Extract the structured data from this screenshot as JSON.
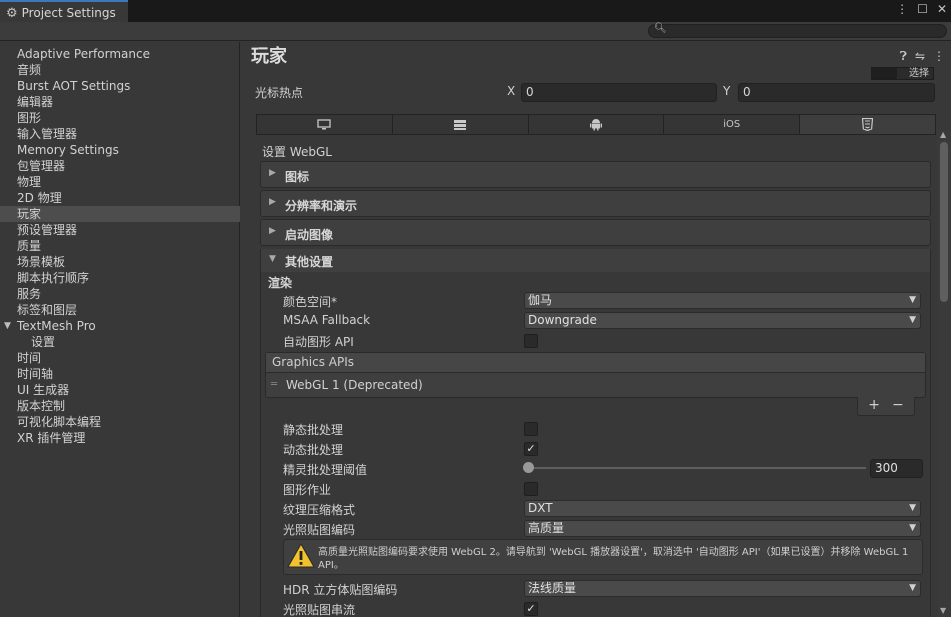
{
  "window": {
    "tab_title": "Project Settings",
    "controls": [
      "⋮",
      "☐",
      "✕"
    ]
  },
  "search": {
    "placeholder": ""
  },
  "sidebar": {
    "items": [
      {
        "label": "Adaptive Performance"
      },
      {
        "label": "音频"
      },
      {
        "label": "Burst AOT Settings"
      },
      {
        "label": "编辑器"
      },
      {
        "label": "图形"
      },
      {
        "label": "输入管理器"
      },
      {
        "label": "Memory Settings"
      },
      {
        "label": "包管理器"
      },
      {
        "label": "物理"
      },
      {
        "label": "2D 物理"
      },
      {
        "label": "玩家",
        "selected": true
      },
      {
        "label": "预设管理器"
      },
      {
        "label": "质量"
      },
      {
        "label": "场景模板"
      },
      {
        "label": "脚本执行顺序"
      },
      {
        "label": "服务"
      },
      {
        "label": "标签和图层"
      },
      {
        "label": "TextMesh Pro",
        "expanded": true
      },
      {
        "label": "设置",
        "child": true
      },
      {
        "label": "时间"
      },
      {
        "label": "时间轴"
      },
      {
        "label": "UI 生成器"
      },
      {
        "label": "版本控制"
      },
      {
        "label": "可视化脚本编程"
      },
      {
        "label": "XR 插件管理"
      }
    ]
  },
  "main": {
    "title": "玩家",
    "select_button": "选择",
    "cursor_hotspot": {
      "label": "光标热点",
      "x_label": "X",
      "x_value": "0",
      "y_label": "Y",
      "y_value": "0"
    },
    "platform_tabs": [
      {
        "icon": "monitor-icon"
      },
      {
        "icon": "server-icon"
      },
      {
        "icon": "android-icon"
      },
      {
        "text": "iOS"
      },
      {
        "icon": "html5-icon",
        "active": true
      }
    ],
    "settings_for": "设置 WebGL",
    "foldouts": [
      "图标",
      "分辨率和演示",
      "启动图像"
    ],
    "other_settings": "其他设置",
    "rendering_header": "渲染",
    "color_space": {
      "label": "颜色空间*",
      "value": "伽马"
    },
    "msaa": {
      "label": "MSAA Fallback",
      "value": "Downgrade"
    },
    "auto_graphics_api": {
      "label": "自动图形 API",
      "checked": false
    },
    "graphics_apis": {
      "header": "Graphics APIs",
      "items": [
        "WebGL 1 (Deprecated)"
      ],
      "add": "+",
      "remove": "−"
    },
    "static_batching": {
      "label": "静态批处理",
      "checked": false
    },
    "dynamic_batching": {
      "label": "动态批处理",
      "checked": true
    },
    "sprite_batching_threshold": {
      "label": "精灵批处理阈值",
      "value": "300",
      "slider_fraction": 0.0
    },
    "graphics_jobs": {
      "label": "图形作业",
      "checked": false
    },
    "texture_compression": {
      "label": "纹理压缩格式",
      "value": "DXT"
    },
    "lightmap_encoding": {
      "label": "光照贴图编码",
      "value": "高质量"
    },
    "warning": "高质量光照贴图编码要求使用 WebGL 2。请导航到 'WebGL 播放器设置'，取消选中 '自动图形 API'（如果已设置）并移除 WebGL 1 API。",
    "hdr_cubemap_encoding": {
      "label": "HDR 立方体贴图编码",
      "value": "法线质量"
    },
    "lightmap_streaming": {
      "label": "光照贴图串流",
      "checked": true
    }
  }
}
